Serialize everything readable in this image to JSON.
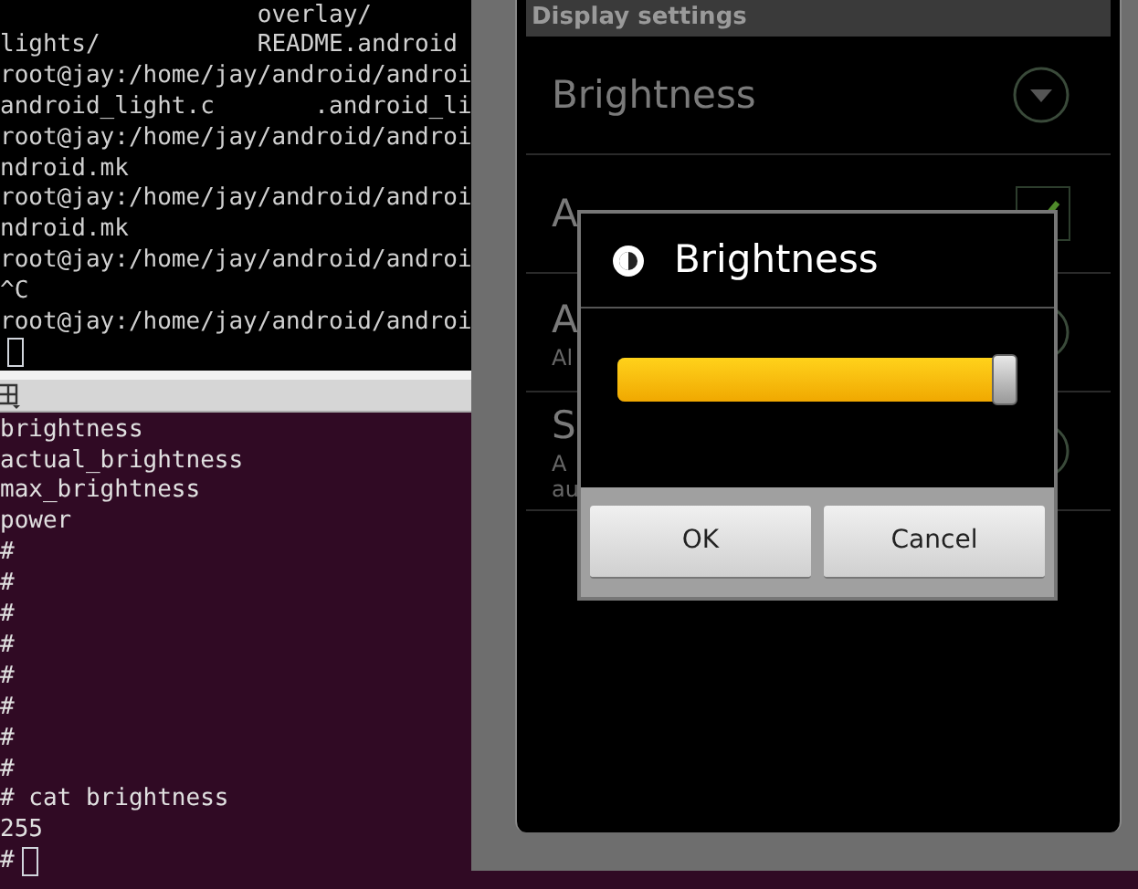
{
  "terminal_top": {
    "lines": [
      {
        "text": "                  overlay/"
      },
      {
        "text": "lights/           README.android"
      },
      {
        "text": "root@jay:/home/jay/android/androi"
      },
      {
        "text": "android_light.c       .android_li"
      },
      {
        "text": "root@jay:/home/jay/android/androi"
      },
      {
        "text": "ndroid.mk"
      },
      {
        "text": "root@jay:/home/jay/android/androi"
      },
      {
        "text": "ndroid.mk"
      },
      {
        "text": "root@jay:/home/jay/android/androi"
      },
      {
        "text": "^C"
      },
      {
        "text": "root@jay:/home/jay/android/androi"
      },
      {
        "cursor": true
      }
    ]
  },
  "terminal_bottom": {
    "lines": [
      {
        "text": "brightness"
      },
      {
        "text": "actual_brightness"
      },
      {
        "text": "max_brightness"
      },
      {
        "text": "power"
      },
      {
        "text": "#"
      },
      {
        "text": "#"
      },
      {
        "text": "#"
      },
      {
        "text": "#"
      },
      {
        "text": "#"
      },
      {
        "text": "#"
      },
      {
        "text": "#"
      },
      {
        "text": "#"
      },
      {
        "text": "# cat brightness"
      },
      {
        "text": "255"
      },
      {
        "text": "#",
        "cursor": true
      }
    ]
  },
  "settings": {
    "header": "Display settings",
    "items": [
      {
        "kind": "dropdown",
        "title": "Brightness"
      },
      {
        "kind": "checkbox",
        "title": "A",
        "checked": true
      },
      {
        "kind": "dropdown",
        "title": "A",
        "summary": [
          "Al"
        ]
      },
      {
        "kind": "dropdown",
        "title": "S",
        "summary": [
          "A",
          "au"
        ]
      }
    ]
  },
  "dialog": {
    "title": "Brightness",
    "slider": {
      "level": 1
    },
    "buttons": [
      "OK",
      "Cancel"
    ]
  }
}
